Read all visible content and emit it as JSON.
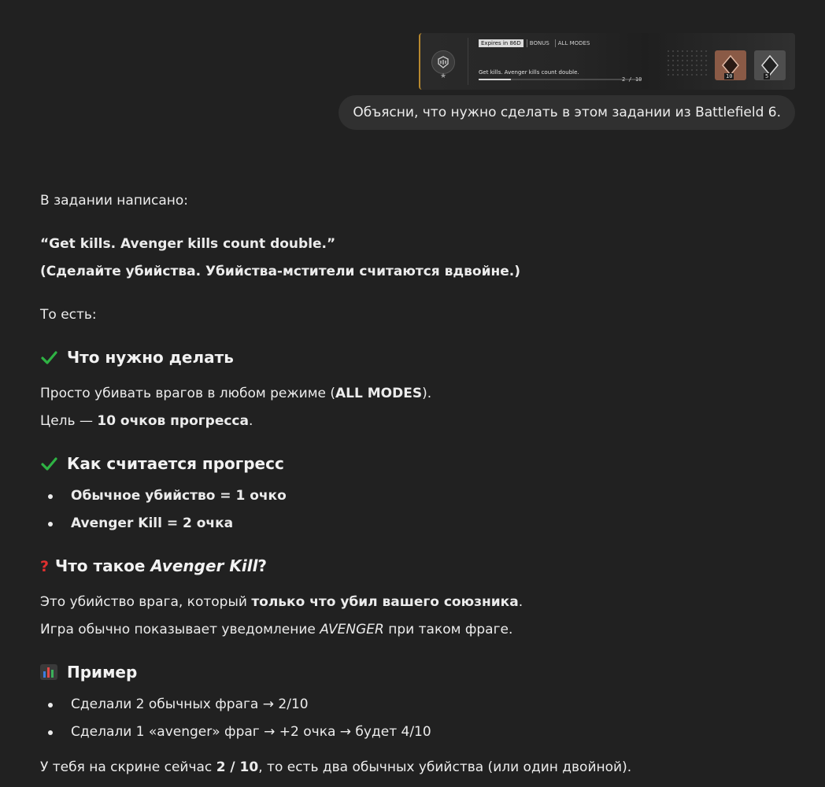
{
  "quest": {
    "expires": "Expires in 86D",
    "tag_bonus": "BONUS",
    "tag_modes": "ALL MODES",
    "description": "Get kills. Avenger kills count double.",
    "progress_text": "2 / 10",
    "progress_fraction": 0.2,
    "reward1_count": "10",
    "reward2_count": "5",
    "accent_color": "#b8892f"
  },
  "user_message": "Объясни, что нужно сделать в этом задании из Battlefield 6.",
  "answer": {
    "intro": "В задании написано:",
    "quote_en": "“Get kills. Avenger kills count double.”",
    "quote_ru": "(Сделайте убийства. Убийства-мстители считаются вдвойне.)",
    "that_is": "То есть:",
    "h_what": "Что нужно делать",
    "what_1_pre": "Просто убивать врагов в любом режиме (",
    "what_1_bold": "ALL MODES",
    "what_1_post": ").",
    "what_2_pre": "Цель — ",
    "what_2_bold": "10 очков прогресса",
    "what_2_post": ".",
    "h_progress": "Как считается прогресс",
    "progress_items": [
      "Обычное убийство = 1 очко",
      "Avenger Kill = 2 очка"
    ],
    "h_avenger_pre": "Что такое ",
    "h_avenger_italic": "Avenger Kill",
    "h_avenger_post": "?",
    "av_1_pre": "Это убийство врага, который ",
    "av_1_bold": "только что убил вашего союзника",
    "av_1_post": ".",
    "av_2_pre": "Игра обычно показывает уведомление ",
    "av_2_italic": "AVENGER",
    "av_2_post": " при таком фраге.",
    "h_example": "Пример",
    "example_items": [
      "Сделали 2 обычных фрага → 2/10",
      "Сделали 1 «avenger» фраг → +2 очка → будет 4/10"
    ],
    "final_pre": "У тебя на скрине сейчас ",
    "final_bold": "2 / 10",
    "final_post": ", то есть два обычных убийства (или один двойной)."
  },
  "icons": {
    "check": "check-mark-icon",
    "question": "question-mark-icon",
    "chart": "bar-chart-icon",
    "check_color": "#2fb344"
  }
}
